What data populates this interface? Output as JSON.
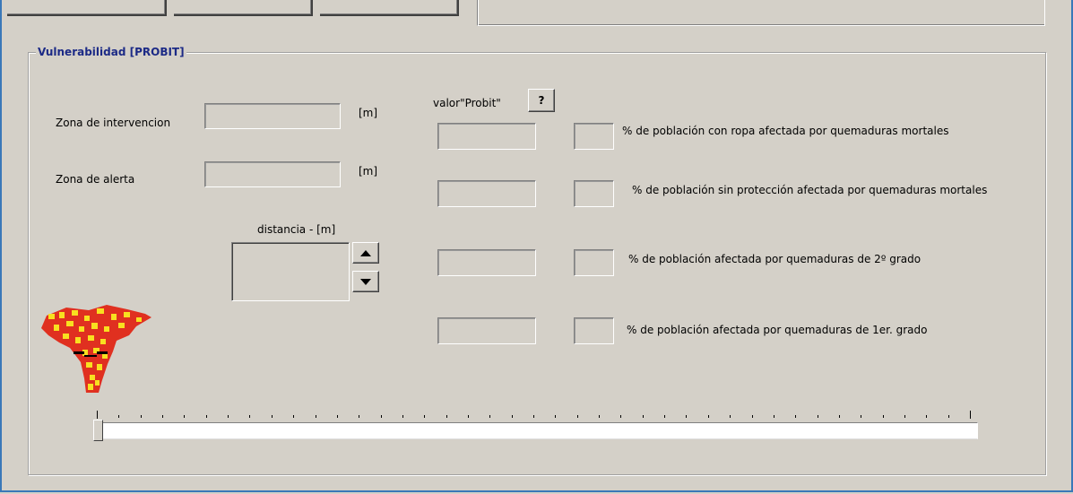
{
  "group": {
    "title": "Vulnerabilidad [PROBIT]"
  },
  "left": {
    "zona_intervencion_label": "Zona de intervencion",
    "zona_intervencion_value": "",
    "zona_alerta_label": "Zona de alerta",
    "zona_alerta_value": "",
    "unit": "[m]",
    "distancia_label": "distancia  -  [m]"
  },
  "probit": {
    "label": "valor\"Probit\"",
    "help": "?",
    "rows": [
      {
        "value": "",
        "pct": "",
        "text": "% de población con ropa afectada por quemaduras mortales"
      },
      {
        "value": "",
        "pct": "",
        "text": "% de población sin protección afectada por quemaduras mortales"
      },
      {
        "value": "",
        "pct": "",
        "text": "% de población afectada por quemaduras de 2º grado"
      },
      {
        "value": "",
        "pct": "",
        "text": "% de población afectada por quemaduras de 1er. grado"
      }
    ]
  },
  "slider": {
    "value": 0
  },
  "icons": {
    "fire": "fire-icon",
    "up": "arrow-up-icon",
    "down": "arrow-down-icon"
  },
  "colors": {
    "accent": "#3a78b8",
    "title": "#1c2a86",
    "fire_red": "#e03020",
    "fire_yellow": "#f8e020"
  }
}
